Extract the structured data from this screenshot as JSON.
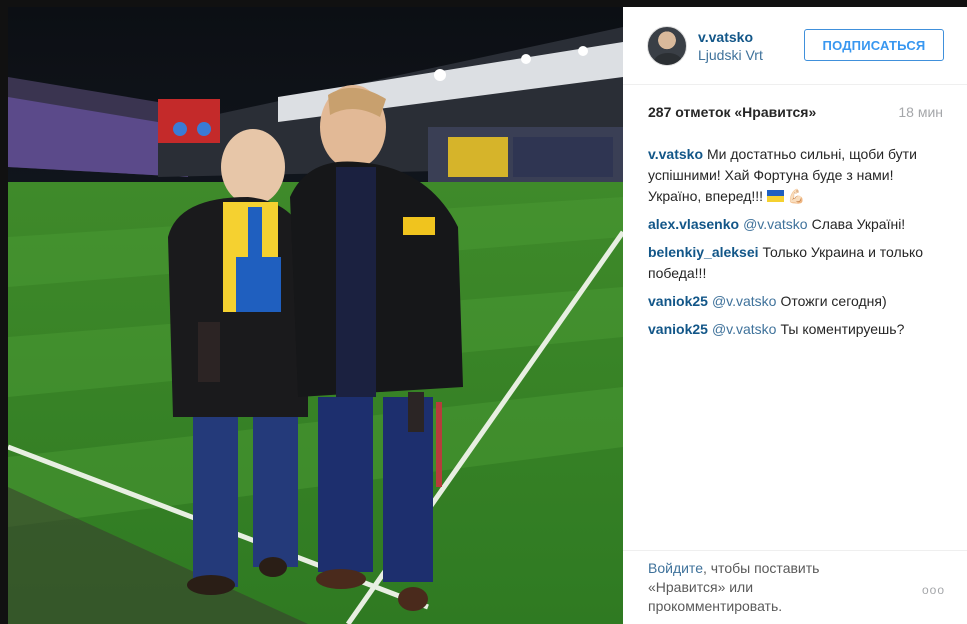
{
  "post": {
    "username": "v.vatsko",
    "location": "Ljudski Vrt",
    "follow_label": "ПОДПИСАТЬСЯ",
    "likes": "287 отметок «Нравится»",
    "time": "18 мин",
    "caption": {
      "user": "v.vatsko",
      "text": "Ми достатньо сильні, щоби бути успішними! Хай Фортуна буде з нами! Україно, вперед!!!",
      "emoji": "💪🏻"
    },
    "comments": [
      {
        "user": "alex.vlasenko",
        "mention": "@v.vatsko",
        "text": "Слава Україні!"
      },
      {
        "user": "belenkiy_aleksei",
        "mention": "",
        "text": "Только Украина и только победа!!!"
      },
      {
        "user": "vaniok25",
        "mention": "@v.vatsko",
        "text": "Отожги сегодня)"
      },
      {
        "user": "vaniok25",
        "mention": "@v.vatsko",
        "text": "Ты коментируешь?"
      }
    ],
    "login_link": "Войдите",
    "login_text": ", чтобы поставить «Нравится» или прокомментировать.",
    "more_label": "ooo"
  },
  "colors": {
    "username": "#125688",
    "link": "#3f729b",
    "follow": "#3897f0",
    "flag_blue": "#1f5fbf",
    "flag_yellow": "#f5d130"
  }
}
